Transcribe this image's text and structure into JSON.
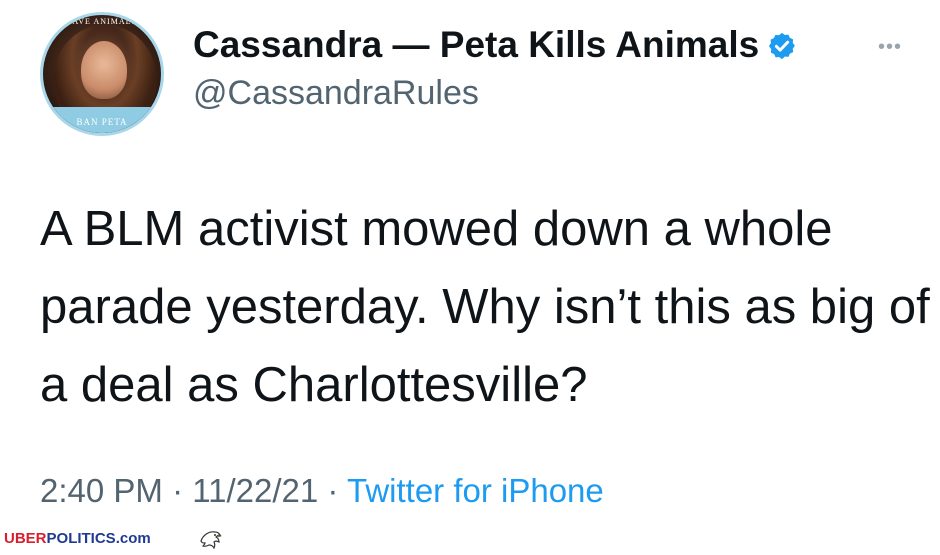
{
  "profile": {
    "avatar_badge_top": "SAVE ANIMALS",
    "avatar_badge_bottom": "BAN PETA",
    "display_name": "Cassandra — Peta Kills Animals",
    "handle": "@CassandraRules",
    "verified": true,
    "verified_icon": "verified-badge-icon",
    "verified_color": "#1d9bf0"
  },
  "menu": {
    "more_label": "•••",
    "icon": "more-options-icon"
  },
  "tweet": {
    "text": "A BLM activist mowed down a whole parade yesterday. Why isn’t this as big of a deal as Charlottesville?",
    "time": "2:40 PM",
    "separator": " · ",
    "date": "11/22/21",
    "source": "Twitter for iPhone"
  },
  "watermark": {
    "part1": "UBER",
    "part2": "POLITICS",
    "part3": ".com",
    "icon": "eagle-icon"
  },
  "colors": {
    "text": "#0f1419",
    "muted": "#536471",
    "link": "#1d9bf0",
    "watermark_red": "#d6202f",
    "watermark_blue": "#1f3a93"
  }
}
